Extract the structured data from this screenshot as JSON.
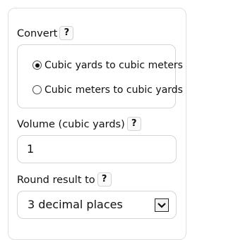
{
  "convert": {
    "label": "Convert",
    "help": "?",
    "options": [
      {
        "label": "Cubic yards to cubic meters",
        "selected": true
      },
      {
        "label": "Cubic meters to cubic yards",
        "selected": false
      }
    ]
  },
  "volume": {
    "label": "Volume (cubic yards)",
    "help": "?",
    "value": "1"
  },
  "round": {
    "label": "Round result to",
    "help": "?",
    "selected": "3 decimal places"
  },
  "icons": {
    "dropdown": "chevron-down-icon",
    "radio_selected": "radio-selected-icon",
    "radio_unselected": "radio-unselected-icon"
  }
}
